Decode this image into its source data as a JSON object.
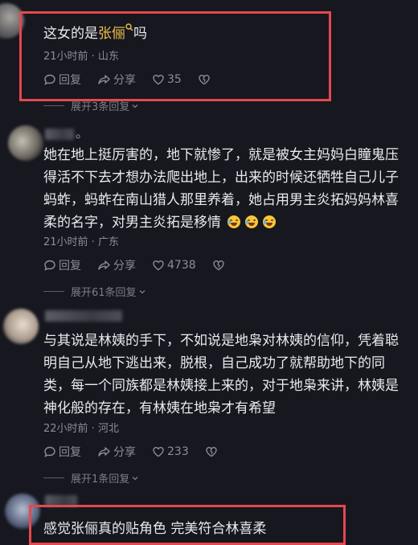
{
  "comments": [
    {
      "text_before": "这女的是",
      "highlight": "张俪",
      "text_after": "吗",
      "meta": "21小时前 · 山东",
      "reply_label": "回复",
      "share_label": "分享",
      "like_count": "35",
      "expand_label": "展开3条回复"
    },
    {
      "name_suffix": "。",
      "text": "她在地上挺厉害的，地下就惨了，就是被女主妈妈白瞳鬼压得活不下去才想办法爬出地上，出来的时候还牺牲自己儿子蚂蚱，蚂蚱在南山猎人那里养着，她占用男主炎拓妈妈林喜柔的名字，对男主炎拓是移情",
      "meta": "21小时前 · 广东",
      "reply_label": "回复",
      "share_label": "分享",
      "like_count": "4738",
      "expand_label": "展开61条回复"
    },
    {
      "text": "与其说是林姨的手下，不如说是地枭对林姨的信仰，凭着聪明自己从地下逃出来，脱根，自己成功了就帮助地下的同类，每一个同族都是林姨接上来的，对于地枭来讲，林姨是神化般的存在，有林姨在地枭才有希望",
      "meta": "22小时前 · 河北",
      "reply_label": "回复",
      "share_label": "分享",
      "like_count": "233",
      "expand_label": "展开1条回复"
    },
    {
      "text": "感觉张俪真的贴角色 完美符合林喜柔"
    }
  ],
  "colors": {
    "background": "#16171f",
    "highlight": "#f2c04b",
    "annotation_box": "#e5484d"
  }
}
